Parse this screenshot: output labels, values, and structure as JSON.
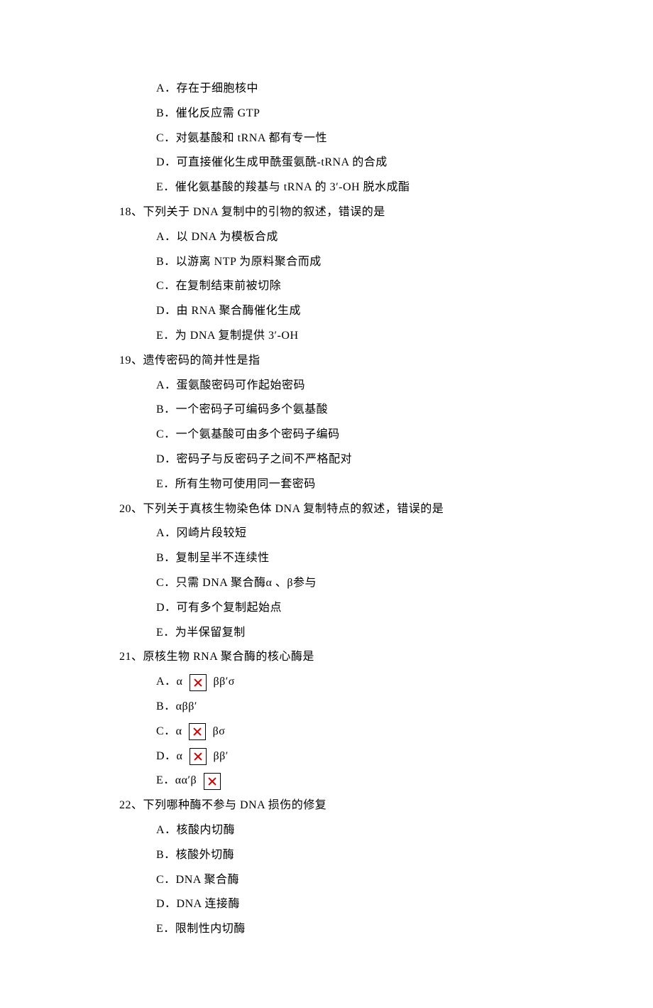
{
  "q17_continued": {
    "options": {
      "A": "A．存在于细胞核中",
      "B": "B．催化反应需 GTP",
      "C": "C．对氨基酸和 tRNA 都有专一性",
      "D": "D．可直接催化生成甲酰蛋氨酰-tRNA 的合成",
      "E": "E．催化氨基酸的羧基与 tRNA 的 3′-OH 脱水成酯"
    }
  },
  "q18": {
    "stem": "18、下列关于 DNA 复制中的引物的叙述，错误的是",
    "options": {
      "A": "A．以 DNA 为模板合成",
      "B": "B．以游离 NTP 为原料聚合而成",
      "C": "C．在复制结束前被切除",
      "D": "D．由 RNA 聚合酶催化生成",
      "E": "E．为 DNA 复制提供 3′-OH"
    }
  },
  "q19": {
    "stem": "19、遗传密码的简并性是指",
    "options": {
      "A": "A．蛋氨酸密码可作起始密码",
      "B": "B．一个密码子可编码多个氨基酸",
      "C": "C．一个氨基酸可由多个密码子编码",
      "D": "D．密码子与反密码子之间不严格配对",
      "E": "E．所有生物可使用同一套密码"
    }
  },
  "q20": {
    "stem": "20、下列关于真核生物染色体 DNA 复制特点的叙述，错误的是",
    "options": {
      "A": "A．冈崎片段较短",
      "B": "B．复制呈半不连续性",
      "C": "C．只需 DNA 聚合酶α 、β参与",
      "D": "D．可有多个复制起始点",
      "E": "E．为半保留复制"
    }
  },
  "q21": {
    "stem": "21、原核生物 RNA 聚合酶的核心酶是",
    "options": {
      "A": {
        "pre": "A．α ",
        "post": " ββ′σ"
      },
      "B": "B．αββ′",
      "C": {
        "pre": "C．α ",
        "post": " βσ"
      },
      "D": {
        "pre": "D．α ",
        "post": " ββ′"
      },
      "E": {
        "pre": "E．αα′β ",
        "post": ""
      }
    }
  },
  "q22": {
    "stem": "22、下列哪种酶不参与 DNA 损伤的修复",
    "options": {
      "A": "A．核酸内切酶",
      "B": "B．核酸外切酶",
      "C": "C．DNA 聚合酶",
      "D": "D．DNA 连接酶",
      "E": "E．限制性内切酶"
    }
  }
}
